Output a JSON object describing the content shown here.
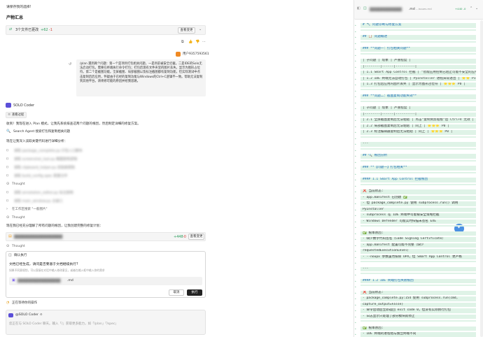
{
  "chat": {
    "top_text": "请保存我的选择!",
    "section_title": "产物汇总",
    "files_changed": "3个文件已更改",
    "files_diff_add": "+62",
    "files_diff_del": "-1",
    "view_changes": "查看变更",
    "user_label": "用户9357593561",
    "user_message": "/plan 遇到两个问题：第一个是项目打包相关问题，一是目前被安全拦截。二是IDE的Solo无法启动打包。需要在终端执行命令打包；打包后现有文件夹里的图片丢失。显示为图形占位符。第二个是截图功能。全屏截图、局部截图以及标注截图都有复制功能，但实际测试中点击复制后后应用，怀疑由于已经的复制功能与Windows的Ctrl+C逻辑不一致。帮助无法复制到其他平台。请将修可能的原因并给我思路。",
    "solo_coder": "SOLO Coder",
    "view_process": "查看过程",
    "received_intro": "收到！我现在进入 Plan 模式，让我先系统排查这两个问题的根因，然后制定详细的修复方案。",
    "search_agent": "Search Agent 搜索打包和复制相关问题",
    "analyzing": "现在让我深入读取关键代码进行详细分析：",
    "blurred_row_1": "读取 package_complete.py 打包入口脚本",
    "blurred_row_2": "读取 screenshot_tool.py 截图复制逻辑",
    "blurred_row_3": "读取 clipboard_helper.py 剪贴板帮助",
    "blurred_row_4": "读取 build_config.spec 配置文件",
    "thought": "Thought",
    "blurred_row_5": "读取 annotation_editor.py 标注复制",
    "blurred_row_6": "读取 main_window.py 主窗口",
    "expand_more": "在工作区搜索 \"一般图片\"",
    "thought2": "Thought",
    "creating_plan": "现在我已经充分理解了所有问题的根因，让我创建完整的修复计划：",
    "plan_file_add": "+448",
    "plan_file_del": "-0",
    "view_changes2": "查看变更",
    "thought3": "Thought",
    "confirm_title": "确认执行",
    "confirm_question": "文档已经生成，请问是否要基于文档继续执行?",
    "confirm_sub": "如果不同意规划，可以直接在对话中输入修改意见，或者在输入框中输入你的需求",
    "doc_suffix": ".md",
    "cancel": "取消",
    "execute": "执行",
    "waiting": "正在等待你的操作",
    "input_mention": "@SOLO Coder",
    "input_placeholder": "您正在与 SOLO Coder 聊天。输入「/」获取更多能力，如「/plan」「/spec」"
  },
  "editor": {
    "tab_title": ".md",
    "tab_sub": "...issues.md",
    "tab_diff": "+440 -0",
    "lines": [
      "# 🔧 问题诊断与修复方案",
      "",
      "## 📋 问题概述",
      "",
      "### **问题一：打包相关问题**",
      "",
      "| 子问题 | 现象 | 严重程度 |",
      "|--------|------|----------|",
      "| 1.1 Smart App Control 拦截 | \"智能应用控制已阻止可能不安全的应用\" | ⭐⭐⭐ P0 |",
      "| 1.2 IDE 终端无法自动打包 | PyInstaller 进程异常退出 | ⭐⭐ P1 |",
      "| 1.3 打包后应用内图片丢失 | 显示为图形占位符 | ⭐⭐⭐ P0 |",
      "",
      "### **问题二：截图复制功能失效**",
      "",
      "| 子问题 | 现象 | 严重程度 |",
      "|--------|------|----------|",
      "| 2.1 全屏截图复制后无法粘贴 | 点击\"复制到剪贴板\"后 Ctrl+V 无效 | ⭐⭐⭐ P0 |",
      "| 2.2 局部截图复制后无法粘贴 | 同上 | ⭐⭐⭐ P0 |",
      "| 2.3 标注编辑器复制后无法粘贴 | 同上 | ⭐⭐⭐ P0 |",
      "",
      "---",
      "",
      "## 🔍 根因分析",
      "",
      "### **【问题一】打包相关**",
      "",
      "#### 1.1 Smart App Control 拦截根因",
      "",
      "❌ 当前状态:",
      "  - app.manifest 已创建 ✅",
      "  - 但 package_complete.py 使用 subprocess.run() 调用",
      "    PyInstaller",
      "  - subprocess 在 IDE 终端中可能被安全策略拦截",
      "  - Windows Defender 可能实时扫描未签名 EXE",
      "",
      "✅ 根本原因:",
      "  - 缺少数字代码签名（Code Signing Certificate）",
      "  - app.manifest 配置可能不完整（缺少",
      "    requestedExecutionLevel）",
      "  - --noupx 参数虽然排除 UPX，但 Smart App Control 更严格",
      "",
      "---",
      "",
      "#### 1.2 IDE 终端打包失败根因",
      "",
      "❌ 当前状态:",
      "  - package_complete.py:154 使用 subprocess.run(cmd,",
      "    capture_output=False)",
      "  - 命令启动后立即返回 exit code 0，但没有实际执行打包",
      "  - 日志显示只处理了部分模块就停止",
      "",
      "✅ 根本原因:",
      "  - IDE 终端的进程组与独立终端不同"
    ]
  }
}
